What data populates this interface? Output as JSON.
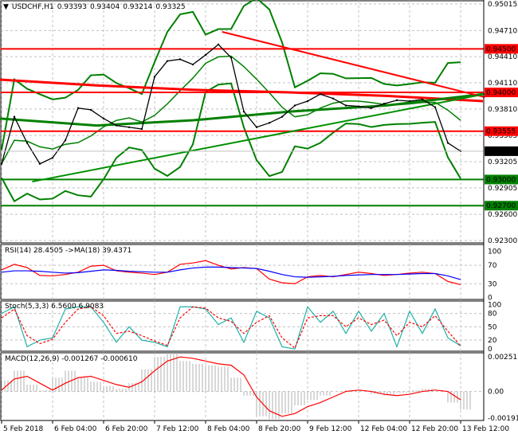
{
  "header": {
    "symbol": "USDCHF,H1",
    "open": "0.93393",
    "high": "0.93404",
    "low": "0.93214",
    "close": "0.93325"
  },
  "chart_data": [
    {
      "type": "line",
      "title": "USDCHF,H1",
      "x_ticks": [
        "5 Feb 2018",
        "6 Feb 04:00",
        "6 Feb 20:00",
        "7 Feb 12:00",
        "8 Feb 04:00",
        "8 Feb 20:00",
        "9 Feb 12:00",
        "12 Feb 04:00",
        "12 Feb 20:00",
        "13 Feb 12:00"
      ],
      "interval_hours": 4,
      "ylim": [
        0.923,
        0.95015
      ],
      "y_ticks": [
        "0.95015",
        "0.94710",
        "0.94410",
        "0.94110",
        "0.93810",
        "0.93505",
        "0.93205",
        "0.92905",
        "0.92600",
        "0.92300"
      ],
      "close": [
        0.9318,
        0.9372,
        0.9342,
        0.9318,
        0.9325,
        0.9345,
        0.9382,
        0.938,
        0.937,
        0.9362,
        0.936,
        0.9358,
        0.9418,
        0.9436,
        0.9438,
        0.9432,
        0.9443,
        0.9455,
        0.944,
        0.9378,
        0.936,
        0.9365,
        0.9372,
        0.9385,
        0.939,
        0.9398,
        0.9393,
        0.9385,
        0.9384,
        0.9382,
        0.9387,
        0.9391,
        0.939,
        0.9392,
        0.9383,
        0.9342,
        0.93325
      ],
      "current_price": {
        "label": "0.93325",
        "color": "#000000"
      },
      "levels": [
        {
          "label": "0.94500",
          "value": 0.945,
          "color": "#ff0000"
        },
        {
          "label": "0.94000",
          "value": 0.94,
          "color": "#ff0000"
        },
        {
          "label": "0.93555",
          "value": 0.93555,
          "color": "#ff0000"
        },
        {
          "label": "0.93000",
          "value": 0.93,
          "color": "#008000"
        },
        {
          "label": "0.92700",
          "value": 0.927,
          "color": "#008000"
        }
      ],
      "trendlines": [
        {
          "color": "#ff0000",
          "from": [
            17.3,
            0.94695
          ],
          "to": [
            37.9,
            0.93945
          ]
        },
        {
          "color": "#009000",
          "from": [
            2.4,
            0.92976
          ],
          "to": [
            37.9,
            0.93981
          ]
        }
      ],
      "slow_ma": [
        {
          "color": "#ff0000",
          "values": [
            0.94147,
            0.9408,
            0.9403,
            0.94,
            0.9396,
            0.939
          ]
        },
        {
          "color": "#008000",
          "values": [
            0.937,
            0.9362,
            0.9368,
            0.9378,
            0.9385,
            0.9398
          ]
        }
      ],
      "bollinger_color": "#008000"
    },
    {
      "type": "line",
      "label": "RSI(14) 28.4505  ->MA(18) 39.4371",
      "ylim": [
        0,
        100
      ],
      "y_ticks": [
        "100",
        "70",
        "30",
        "0"
      ],
      "series": [
        {
          "color": "#ff0000",
          "values": [
            60,
            72,
            65,
            48,
            47,
            50,
            55,
            68,
            70,
            58,
            55,
            53,
            50,
            55,
            72,
            75,
            80,
            70,
            62,
            65,
            63,
            40,
            32,
            30,
            45,
            48,
            45,
            50,
            55,
            52,
            48,
            50,
            53,
            55,
            52,
            35,
            28
          ]
        },
        {
          "color": "#0000ff",
          "values": [
            55,
            58,
            58,
            57,
            55,
            53,
            54,
            57,
            60,
            59,
            57,
            56,
            55,
            55,
            60,
            64,
            66,
            66,
            65,
            64,
            63,
            57,
            50,
            45,
            44,
            45,
            46,
            48,
            49,
            50,
            50,
            50,
            51,
            52,
            52,
            47,
            39
          ]
        }
      ]
    },
    {
      "type": "line",
      "label": "Stoch(5,3,3) 6.5600 6.9083",
      "ylim": [
        0,
        100
      ],
      "y_ticks": [
        "100",
        "80",
        "50",
        "20",
        "0"
      ],
      "series": [
        {
          "color": "#20b2aa",
          "values": [
            80,
            95,
            5,
            20,
            25,
            90,
            95,
            95,
            60,
            15,
            50,
            20,
            15,
            5,
            95,
            95,
            90,
            55,
            70,
            15,
            85,
            70,
            5,
            0,
            95,
            60,
            85,
            35,
            85,
            40,
            80,
            5,
            85,
            35,
            90,
            25,
            7
          ]
        },
        {
          "color": "#ff0000",
          "dashed": true,
          "values": [
            70,
            90,
            30,
            12,
            22,
            60,
            90,
            95,
            75,
            35,
            40,
            30,
            18,
            8,
            70,
            95,
            92,
            70,
            62,
            35,
            60,
            75,
            25,
            2,
            70,
            75,
            75,
            50,
            70,
            55,
            65,
            30,
            60,
            50,
            75,
            40,
            7
          ]
        }
      ]
    },
    {
      "type": "bar",
      "label": "MACD(12,26,9) -0.001267 -0.000610",
      "ylim": [
        -0.002,
        0.0027
      ],
      "y_ticks": [
        "0.00251",
        "0.00",
        "-0.001914"
      ],
      "histogram": [
        0.0008,
        0.0015,
        0.0005,
        0.0001,
        0.001,
        0.0015,
        0.001,
        0.0007,
        0.0004,
        0.0002,
        0.0006,
        0.0016,
        0.0025,
        0.0028,
        0.0022,
        0.002,
        0.0019,
        0.0018,
        0.001,
        -0.0003,
        -0.0018,
        -0.002,
        -0.0016,
        -0.001,
        -0.0006,
        -0.0003,
        0.0,
        0.0001,
        0.0,
        -0.0002,
        -0.0003,
        -0.0001,
        0.0001,
        0.0002,
        0.0,
        -0.0008,
        -0.0013
      ],
      "signal": [
        0.0001,
        0.0009,
        0.0011,
        0.0006,
        0.0001,
        0.0006,
        0.001,
        0.0011,
        0.0008,
        0.0005,
        0.0003,
        0.0007,
        0.0015,
        0.0022,
        0.0025,
        0.0024,
        0.0022,
        0.002,
        0.0019,
        0.0012,
        -0.0004,
        -0.0014,
        -0.0018,
        -0.0016,
        -0.0011,
        -0.0008,
        -0.0004,
        0.0,
        0.0001,
        0.0,
        -0.0002,
        -0.0003,
        -0.0002,
        0.0,
        0.0001,
        0.0,
        -0.0006
      ]
    }
  ]
}
